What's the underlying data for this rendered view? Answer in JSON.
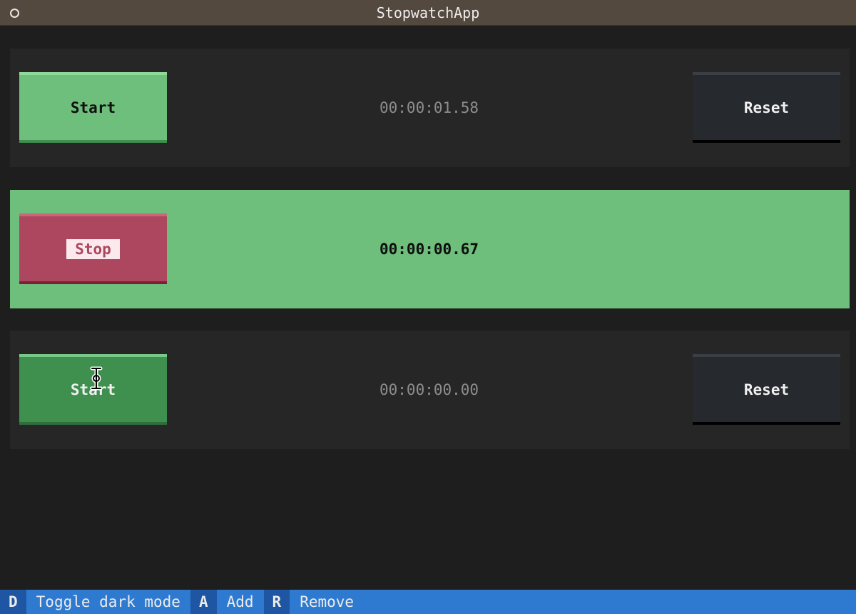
{
  "window": {
    "title": "StopwatchApp"
  },
  "stopwatches": [
    {
      "start_label": "Start",
      "time": "00:00:01.58",
      "reset_label": "Reset"
    },
    {
      "stop_label": "Stop",
      "time": "00:00:00.67"
    },
    {
      "start_label": "Start",
      "time": "00:00:00.00",
      "reset_label": "Reset"
    }
  ],
  "footer": {
    "bindings": [
      {
        "key": "D",
        "description": "Toggle dark mode"
      },
      {
        "key": "A",
        "description": "Add"
      },
      {
        "key": "R",
        "description": "Remove"
      }
    ]
  },
  "colors": {
    "background": "#1e1e1e",
    "active_row": "#6ebe7c",
    "start_button": "#6ebe7c",
    "start_button_focused": "#3f8f4f",
    "stop_button": "#ad475f",
    "reset_button": "#26292e",
    "footer": "#2f7ad1",
    "footer_key": "#1f56a3",
    "title_bar": "#54493f"
  }
}
